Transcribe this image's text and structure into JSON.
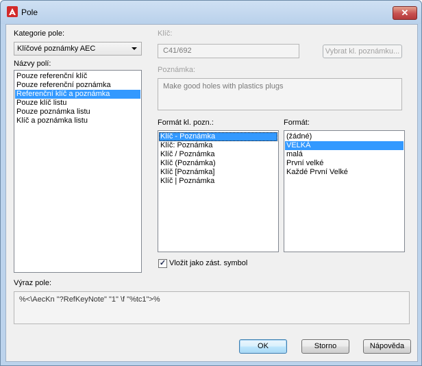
{
  "window": {
    "title": "Pole",
    "close_glyph": "✕"
  },
  "kategorie": {
    "label": "Kategorie pole:",
    "selected": "Klíčové poznámky AEC"
  },
  "nazvy": {
    "label": "Názvy polí:",
    "items": [
      "Pouze referenční klíč",
      "Pouze referenční poznámka",
      "Referenční klíč a poznámka",
      "Pouze klíč listu",
      "Pouze poznámka listu",
      "Klíč a poznámka listu"
    ],
    "selected_index": 2
  },
  "klic": {
    "label": "Klíč:",
    "value": "C41/692",
    "button": "Vybrat kl. poznámku..."
  },
  "poznamka": {
    "label": "Poznámka:",
    "value": "Make good holes with plastics plugs"
  },
  "format_kl": {
    "label": "Formát kl. pozn.:",
    "items": [
      "Klíč - Poznámka",
      "Klíč: Poznámka",
      "Klíč / Poznámka",
      "Klíč (Poznámka)",
      "Klíč [Poznámka]",
      "Klíč | Poznámka"
    ],
    "selected_index": 0
  },
  "format": {
    "label": "Formát:",
    "items": [
      "(žádné)",
      "VELKÁ",
      "malá",
      "První velké",
      "Každé První Velké"
    ],
    "selected_index": 1
  },
  "vlozit": {
    "label": "Vložit jako zást. symbol",
    "checked": true,
    "check_glyph": "✓"
  },
  "vyraz": {
    "label": "Výraz pole:",
    "value": "%<\\AecKn \"?RefKeyNote\" \"1\" \\f \"%tc1\">%"
  },
  "buttons": {
    "ok": "OK",
    "storno": "Storno",
    "napoveda": "Nápověda"
  },
  "colors": {
    "selection": "#3399ff",
    "app_icon": "#d32a2a"
  }
}
